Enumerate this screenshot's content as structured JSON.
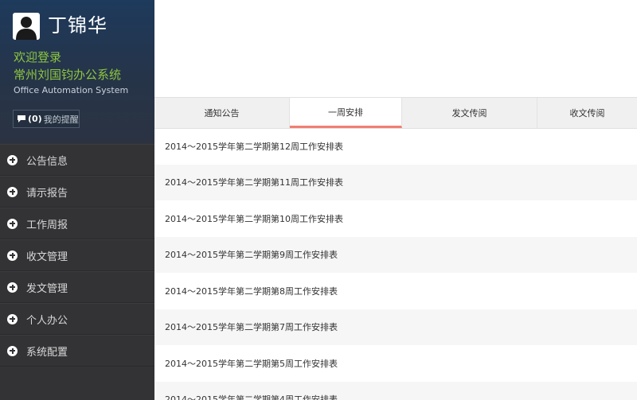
{
  "user": {
    "name": "丁锦华",
    "welcome": "欢迎登录",
    "company": "常州刘国钧办公系统",
    "system_en": "Office Automation System",
    "reminder_count": "(0)",
    "reminder_label": "我的提醒"
  },
  "sidebar": {
    "items": [
      {
        "label": "公告信息"
      },
      {
        "label": "请示报告"
      },
      {
        "label": "工作周报"
      },
      {
        "label": "收文管理"
      },
      {
        "label": "发文管理"
      },
      {
        "label": "个人办公"
      },
      {
        "label": "系统配置"
      }
    ]
  },
  "tabs": [
    {
      "label": "通知公告"
    },
    {
      "label": "一周安排"
    },
    {
      "label": "发文传阅"
    },
    {
      "label": "收文传阅"
    }
  ],
  "list": [
    {
      "title": "2014～2015学年第二学期第12周工作安排表"
    },
    {
      "title": "2014～2015学年第二学期第11周工作安排表"
    },
    {
      "title": "2014～2015学年第二学期第10周工作安排表"
    },
    {
      "title": "2014～2015学年第二学期第9周工作安排表"
    },
    {
      "title": "2014～2015学年第二学期第8周工作安排表"
    },
    {
      "title": "2014～2015学年第二学期第7周工作安排表"
    },
    {
      "title": "2014～2015学年第二学期第5周工作安排表"
    },
    {
      "title": "2014～2015学年第二学期第4周工作安排表"
    }
  ],
  "colors": {
    "accent_green": "#8dc63f",
    "active_tab_underline": "#f07f72",
    "sidebar_bg": "#333336"
  }
}
